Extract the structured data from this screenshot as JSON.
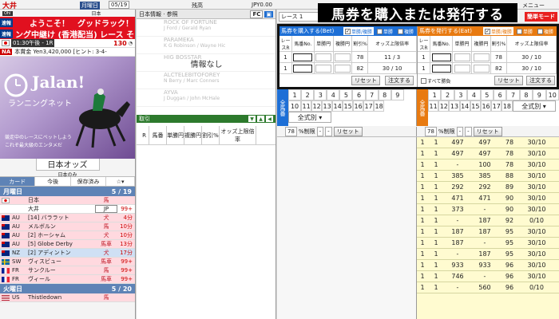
{
  "topbar": {
    "venue": "大井",
    "day_label": "月曜日",
    "date": "05/19",
    "center": "残高",
    "balance": "JPY0.00",
    "menu": "メニュー"
  },
  "left": {
    "venue": "大井",
    "country": "日本",
    "ticker1_tag": "速報",
    "ticker1": "ようこそ！　グッドラック！",
    "ticker2_tag": "速報",
    "ticker2": "ング中継け (香港配当) レース そし",
    "race_time": "01:30午後 - 1R",
    "minutes": "130",
    "race_info": "本賞金 Yen3,420,000 [ヒント: 3-4-",
    "promo": {
      "brand": "Jalan!",
      "sub": "ランニングネット",
      "copy1": "競走中のレースにベットしよう",
      "copy2": "これぞ最大級のエンタメだ"
    },
    "odds_title": "日本オッズ",
    "odds_sub": "日本のみ",
    "tabs": [
      "カード",
      "今後",
      "保存済み"
    ],
    "days": [
      {
        "name": "月曜日",
        "count": "5 / 19"
      },
      {
        "name": "火曜日",
        "count": "5 / 20"
      }
    ],
    "mon_races": [
      {
        "cc": "",
        "name": "日本",
        "type": "馬",
        "time": "",
        "flag": "jp",
        "bg": "#ffd9df"
      },
      {
        "cc": "",
        "name": "大井",
        "type": "JP",
        "time": "99+",
        "flag": "",
        "bg": "#ffffff"
      },
      {
        "cc": "AU",
        "name": "[14] バララット",
        "type": "犬",
        "time": "4分",
        "flag": "au",
        "bg": "#ffd9df"
      },
      {
        "cc": "AU",
        "name": "メルボルン",
        "type": "馬",
        "time": "10分",
        "flag": "au",
        "bg": "#ffd9df"
      },
      {
        "cc": "AU",
        "name": "[2] ホーシャム",
        "type": "犬",
        "time": "10分",
        "flag": "au",
        "bg": "#ffd9df"
      },
      {
        "cc": "AU",
        "name": "[5] Globe Derby",
        "type": "馬車",
        "time": "13分",
        "flag": "au",
        "bg": "#ffd9df"
      },
      {
        "cc": "NZ",
        "name": "[2] アディントン",
        "type": "犬",
        "time": "17分",
        "flag": "nz",
        "bg": "#cfe0f4"
      },
      {
        "cc": "SW",
        "name": "ヴィスビュー",
        "type": "馬車",
        "time": "99+",
        "flag": "se",
        "bg": "#ffd9df"
      },
      {
        "cc": "FR",
        "name": "サンクルー",
        "type": "馬",
        "time": "99+",
        "flag": "fr",
        "bg": "#ffd9df"
      },
      {
        "cc": "FR",
        "name": "ヴィール",
        "type": "馬車",
        "time": "99+",
        "flag": "fr",
        "bg": "#ffd9df"
      }
    ],
    "tue_races": [
      {
        "cc": "US",
        "name": "Thistledown",
        "type": "馬",
        "time": "",
        "flag": "us",
        "bg": "#ffd9df"
      }
    ]
  },
  "mid": {
    "header": "日本情報 · 参照",
    "fc": "FC",
    "horses": [
      "ROCK OF FORTUNE",
      "PARAMEKA",
      "HIG BOSSTAR",
      "ALCTELEBITOFOREY",
      "AYVA"
    ],
    "jockeys": [
      "J Ford / Gerald Ryan",
      "K G Robinson / Wayne Hic",
      "",
      "N Berry / Marc Conners",
      "J Duggan / John McHale"
    ],
    "no_info": "情報なし",
    "bet_bar": "取引",
    "cols": [
      "R",
      "馬番",
      "単勝円",
      "複勝円",
      "割引%",
      "オッズ上限倍率"
    ]
  },
  "callout": "馬券を購入または発行する",
  "bet": {
    "race_select": "レース 1",
    "easy_mode": "簡単モード",
    "buy_title": "馬券を購入する(Bet)",
    "sell_title": "馬券を発行する(Eat)",
    "mode_win": "単勝/複勝",
    "mode_tan": "単勝",
    "mode_fuku": "複勝",
    "cols": [
      "レースR",
      "馬番No.",
      "単勝円",
      "複勝円",
      "割引%",
      "オッズ上限倍率"
    ],
    "buy_rows": [
      {
        "race": "1",
        "no": "",
        "tan": "",
        "fuku": "",
        "disc": "78",
        "limit": "11 / 3"
      },
      {
        "race": "1",
        "no": "",
        "tan": "",
        "fuku": "",
        "disc": "82",
        "limit": "30 / 10"
      }
    ],
    "sell_rows": [
      {
        "race": "1",
        "no": "",
        "tan": "",
        "fuku": "",
        "disc": "78",
        "limit": "30 / 10"
      },
      {
        "race": "1",
        "no": "",
        "tan": "",
        "fuku": "",
        "disc": "82",
        "limit": "30 / 10"
      }
    ],
    "reset": "リセット",
    "order": "注文する",
    "all_horses": "すべて勝負"
  },
  "grids": {
    "label_left": "全馬番",
    "label_right": "全馬番",
    "nums": [
      "1",
      "2",
      "3",
      "4",
      "5",
      "6",
      "7",
      "8",
      "9",
      "10",
      "11",
      "12",
      "13",
      "14",
      "15",
      "16",
      "17",
      "18"
    ],
    "filter": "全式別",
    "pct": "78",
    "pct_label": "%制限",
    "dash": "-",
    "reset": "リセット"
  },
  "odds_rows": [
    {
      "r": "1",
      "h": "1",
      "tan": "497",
      "fuku": "497",
      "pct": "78",
      "lim": "30/10"
    },
    {
      "r": "1",
      "h": "1",
      "tan": "497",
      "fuku": "497",
      "pct": "78",
      "lim": "30/10"
    },
    {
      "r": "1",
      "h": "1",
      "tan": "-",
      "fuku": "100",
      "pct": "78",
      "lim": "30/10"
    },
    {
      "r": "1",
      "h": "1",
      "tan": "385",
      "fuku": "385",
      "pct": "88",
      "lim": "30/10"
    },
    {
      "r": "1",
      "h": "1",
      "tan": "292",
      "fuku": "292",
      "pct": "89",
      "lim": "30/10"
    },
    {
      "r": "1",
      "h": "1",
      "tan": "471",
      "fuku": "471",
      "pct": "90",
      "lim": "30/10"
    },
    {
      "r": "1",
      "h": "1",
      "tan": "373",
      "fuku": "-",
      "pct": "90",
      "lim": "30/10"
    },
    {
      "r": "1",
      "h": "1",
      "tan": "-",
      "fuku": "187",
      "pct": "92",
      "lim": "0/10"
    },
    {
      "r": "1",
      "h": "1",
      "tan": "187",
      "fuku": "187",
      "pct": "95",
      "lim": "30/10"
    },
    {
      "r": "1",
      "h": "1",
      "tan": "187",
      "fuku": "-",
      "pct": "95",
      "lim": "30/10"
    },
    {
      "r": "1",
      "h": "1",
      "tan": "-",
      "fuku": "187",
      "pct": "95",
      "lim": "30/10"
    },
    {
      "r": "1",
      "h": "1",
      "tan": "933",
      "fuku": "933",
      "pct": "96",
      "lim": "30/10"
    },
    {
      "r": "1",
      "h": "1",
      "tan": "746",
      "fuku": "-",
      "pct": "96",
      "lim": "30/10"
    },
    {
      "r": "1",
      "h": "1",
      "tan": "-",
      "fuku": "560",
      "pct": "96",
      "lim": "0/10"
    }
  ]
}
